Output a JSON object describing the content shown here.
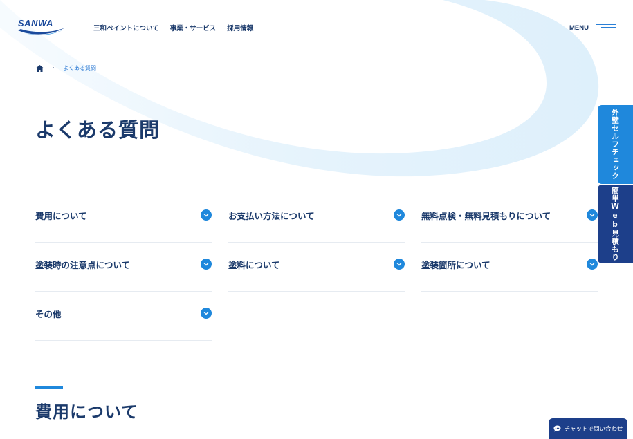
{
  "brand": {
    "logo_text": "SANWA"
  },
  "nav": [
    {
      "label": "三和ペイントについて"
    },
    {
      "label": "事業・サービス"
    },
    {
      "label": "採用情報"
    }
  ],
  "menu": {
    "label": "MENU"
  },
  "breadcrumb": {
    "separator": "・",
    "current": "よくある質問"
  },
  "page": {
    "title": "よくある質問"
  },
  "side_tabs": [
    {
      "label": "外壁セルフチェック",
      "color": "#1f88dc"
    },
    {
      "label": "簡単Web見積もり",
      "color": "#1d3f8a"
    }
  ],
  "categories": [
    {
      "label": "費用について"
    },
    {
      "label": "お支払い方法について"
    },
    {
      "label": "無料点検・無料見積もりについて"
    },
    {
      "label": "塗装時の注意点について"
    },
    {
      "label": "塗料について"
    },
    {
      "label": "塗装箇所について"
    },
    {
      "label": "その他"
    }
  ],
  "section": {
    "title": "費用について"
  },
  "chat": {
    "label": "チャットで問い合わせ"
  },
  "colors": {
    "primary": "#1b3a6b",
    "accent": "#1f88dc",
    "dark_accent": "#1d3f8a"
  }
}
